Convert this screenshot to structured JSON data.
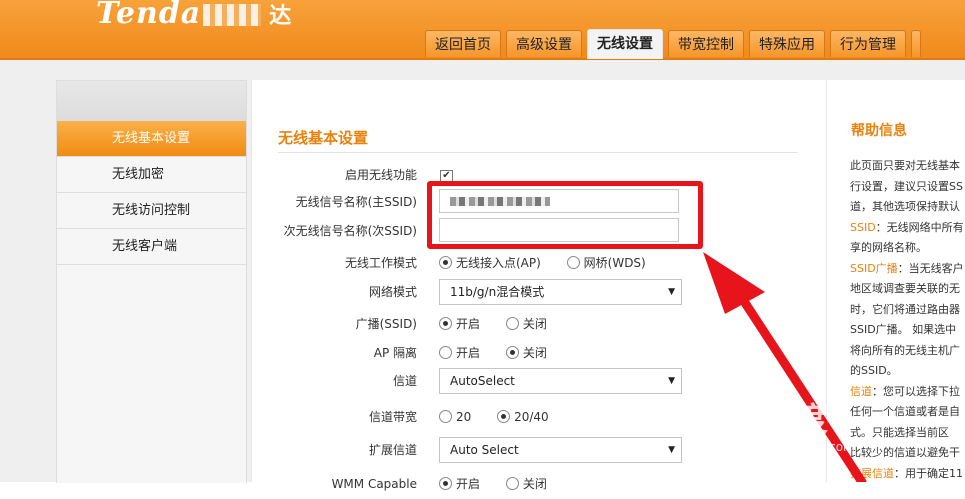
{
  "header": {
    "logo_text": "Tenda",
    "logo_suffix": "达",
    "tabs": [
      {
        "label": "返回首页"
      },
      {
        "label": "高级设置"
      },
      {
        "label": "无线设置"
      },
      {
        "label": "带宽控制"
      },
      {
        "label": "特殊应用"
      },
      {
        "label": "行为管理"
      }
    ]
  },
  "sidebar": {
    "items": [
      {
        "label": "无线基本设置"
      },
      {
        "label": "无线加密"
      },
      {
        "label": "无线访问控制"
      },
      {
        "label": "无线客户端"
      }
    ]
  },
  "form": {
    "section_title": "无线基本设置",
    "enable_label": "启用无线功能",
    "enable_checked": "✔",
    "ssid_label": "无线信号名称(主SSID)",
    "ssid2_label": "次无线信号名称(次SSID)",
    "ssid2_value": "",
    "mode_label": "无线工作模式",
    "mode_ap": "无线接入点(AP)",
    "mode_wds": "网桥(WDS)",
    "netmode_label": "网络模式",
    "netmode_value": "11b/g/n混合模式",
    "broadcast_label": "广播(SSID)",
    "on_label": "开启",
    "off_label": "关闭",
    "ap_iso_label": "AP 隔离",
    "channel_label": "信道",
    "channel_value": "AutoSelect",
    "bandwidth_label": "信道带宽",
    "bw_20": "20",
    "bw_2040": "20/40",
    "ext_channel_label": "扩展信道",
    "ext_channel_value": "Auto Select",
    "wmm_label": "WMM Capable"
  },
  "help": {
    "title": "帮助信息",
    "line1": "此页面只要对无线基本",
    "line2": "行设置，建议只设置SS",
    "line3": "道，其他选项保持默认",
    "k1": "SSID",
    "line4": "：无线网络中所有",
    "line5": "享的网络名称。",
    "k2": "SSID广播",
    "line6": "：当无线客户",
    "line7": "地区域调查要关联的无",
    "line8": "时，它们将通过路由器",
    "line9": "SSID广播。 如果选中",
    "line10": "将向所有的无线主机广",
    "line11": "的SSID。",
    "k3": "信道",
    "line12": "：您可以选择下拉",
    "line13": "任何一个信道或者是自",
    "line14": "式。只能选择当前区",
    "line15": "比较少的信道以避免干",
    "k4": "扩展信道",
    "line16": "：用于确定11"
  },
  "watermark": {
    "text": "Bai度",
    "sub": "jingyan.baidu.com"
  }
}
